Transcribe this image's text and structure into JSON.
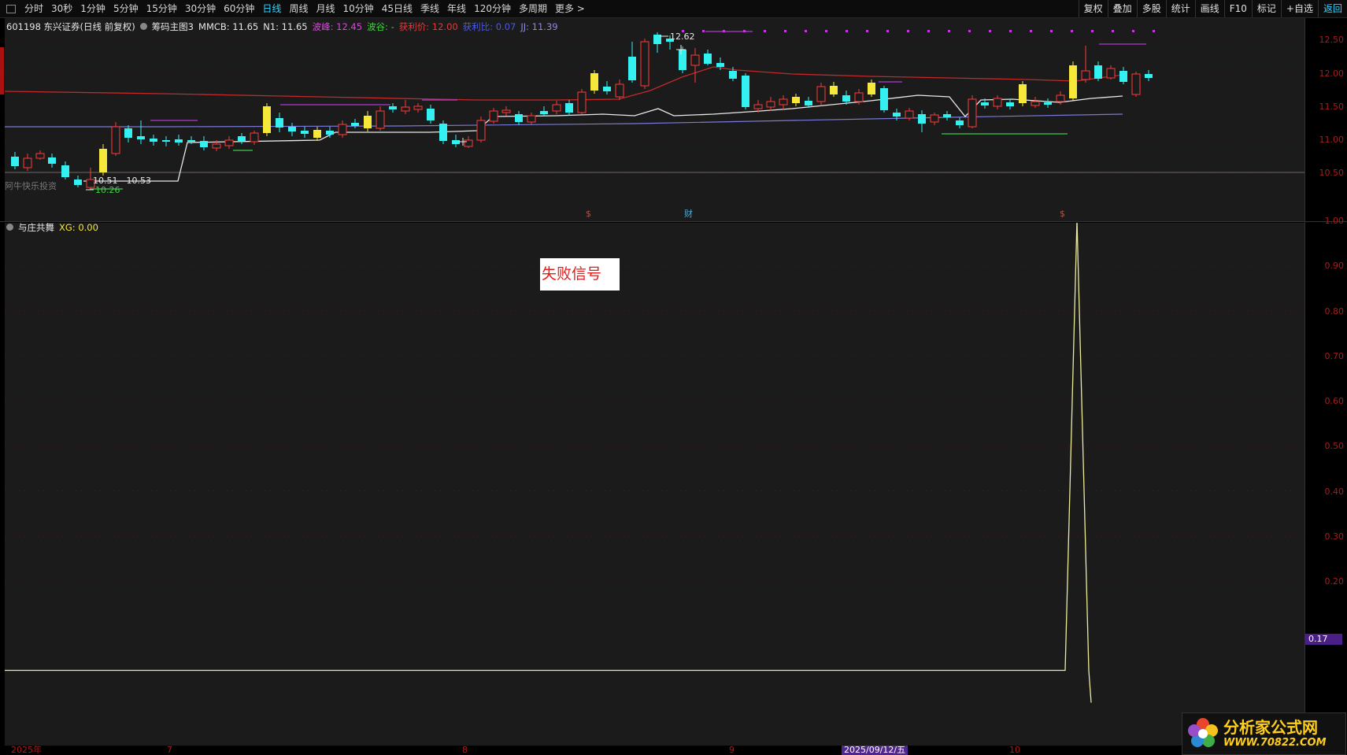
{
  "toolbar": {
    "periods": [
      "分时",
      "30秒",
      "1分钟",
      "5分钟",
      "15分钟",
      "30分钟",
      "60分钟",
      "日线",
      "周线",
      "月线",
      "10分钟",
      "45日线",
      "季线",
      "年线",
      "120分钟",
      "多周期",
      "更多 >"
    ],
    "active_period": "日线",
    "tools": [
      "复权",
      "叠加",
      "多股",
      "统计",
      "画线",
      "F10",
      "标记",
      "+自选",
      "返回"
    ]
  },
  "info": {
    "stock": "601198 东兴证券(日线 前复权)",
    "indicator": "筹码主图3",
    "mmcb": "MMCB: 11.65",
    "n1": "N1: 11.65",
    "peak": "波峰: 12.45",
    "valley": "波谷: -",
    "profit_price": "获利价: 12.00",
    "profit_ratio": "获利比: 0.07",
    "jj": "JJ: 11.39"
  },
  "main_chart": {
    "price_ticks": [
      "12.50",
      "12.00",
      "11.50",
      "11.00",
      "10.50"
    ],
    "annotation_high": "12.62",
    "annotation_range": "10.51 - 10.53",
    "annotation_low": "10.26",
    "watermark": "阿牛快乐投资",
    "markers": [
      "$",
      "财",
      "$"
    ]
  },
  "sub_chart": {
    "name": "与庄共舞",
    "xg": "XG: 0.00",
    "ticks": [
      "1.00",
      "0.90",
      "0.80",
      "0.70",
      "0.60",
      "0.50",
      "0.40",
      "0.30",
      "0.20"
    ],
    "current_value": "0.17",
    "callout": "失败信号"
  },
  "dates": [
    "2025年",
    "7",
    "8",
    "9",
    "2025/09/12/五",
    "10"
  ],
  "logo": {
    "title": "分析家公式网",
    "url": "WWW.70822.COM"
  },
  "colors": {
    "up": "#ff3a3a",
    "down": "#35f0f0",
    "signal": "#f5e83a",
    "line_signal": "#ecec9a",
    "axis": "#a81c1c"
  }
}
